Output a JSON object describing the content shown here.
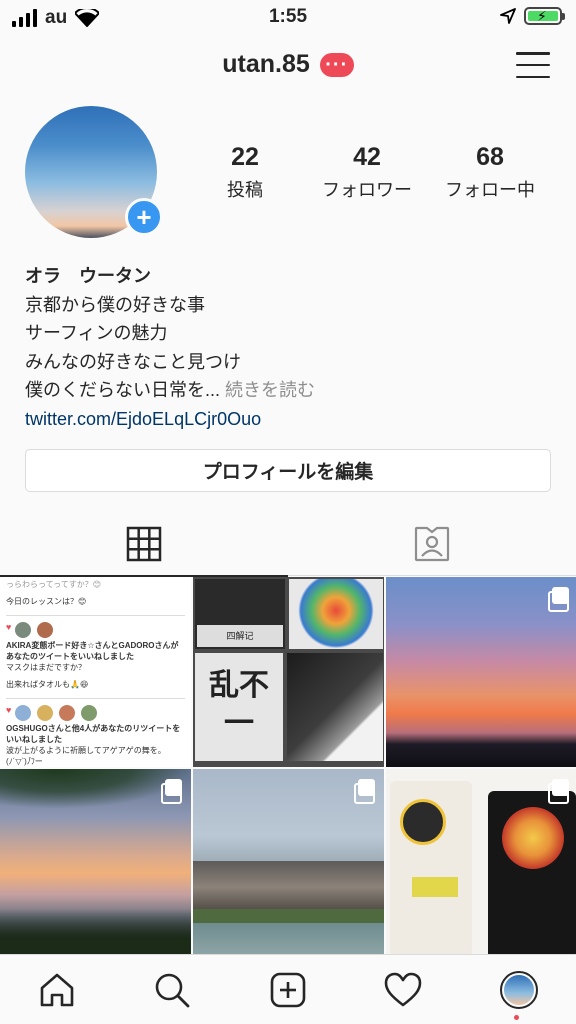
{
  "status_bar": {
    "carrier": "au",
    "time": "1:55"
  },
  "header": {
    "username": "utan.85",
    "badge": "···"
  },
  "profile": {
    "stats": [
      {
        "value": "22",
        "label": "投稿"
      },
      {
        "value": "42",
        "label": "フォロワー"
      },
      {
        "value": "68",
        "label": "フォロー中"
      }
    ],
    "name": "オラ　ウータン",
    "bio_lines": [
      "京都から僕の好きな事",
      "サーフィンの魅力",
      "みんなの好きなこと見つけ",
      "僕のくだらない日常を..."
    ],
    "more_label": "続きを読む",
    "link": "twitter.com/EjdoELqLCjr0Ouo",
    "edit_button": "プロフィールを編集"
  },
  "grid": {
    "notification_post": {
      "line1": "っらわらってってすか？😊",
      "line2": "今日のレッスンは？😊",
      "like1": "AKIRA変態ボード好き☆さんとGADOROさんがあなたのツイートをいいねしました",
      "reply1": "マスクはまだですか？",
      "reply2": "出来ればタオルも🙏😆",
      "like2": "OGSHUGOさんと他4人があなたのリツイートをいいねしました",
      "reply3": "波が上がるように祈願してアゲアゲの舞を。",
      "reply4": "(ﾉ´▽`)ﾉ゚ﾌー"
    },
    "cd_labels": {
      "cd1": "四解记",
      "cd2": "乱不一"
    }
  },
  "colors": {
    "accent": "#3897f0",
    "badge": "#ed4956",
    "link": "#003569"
  },
  "icons": [
    "home-icon",
    "search-icon",
    "add-post-icon",
    "heart-icon",
    "profile-avatar-icon",
    "grid-icon",
    "tagged-icon",
    "menu-icon"
  ]
}
